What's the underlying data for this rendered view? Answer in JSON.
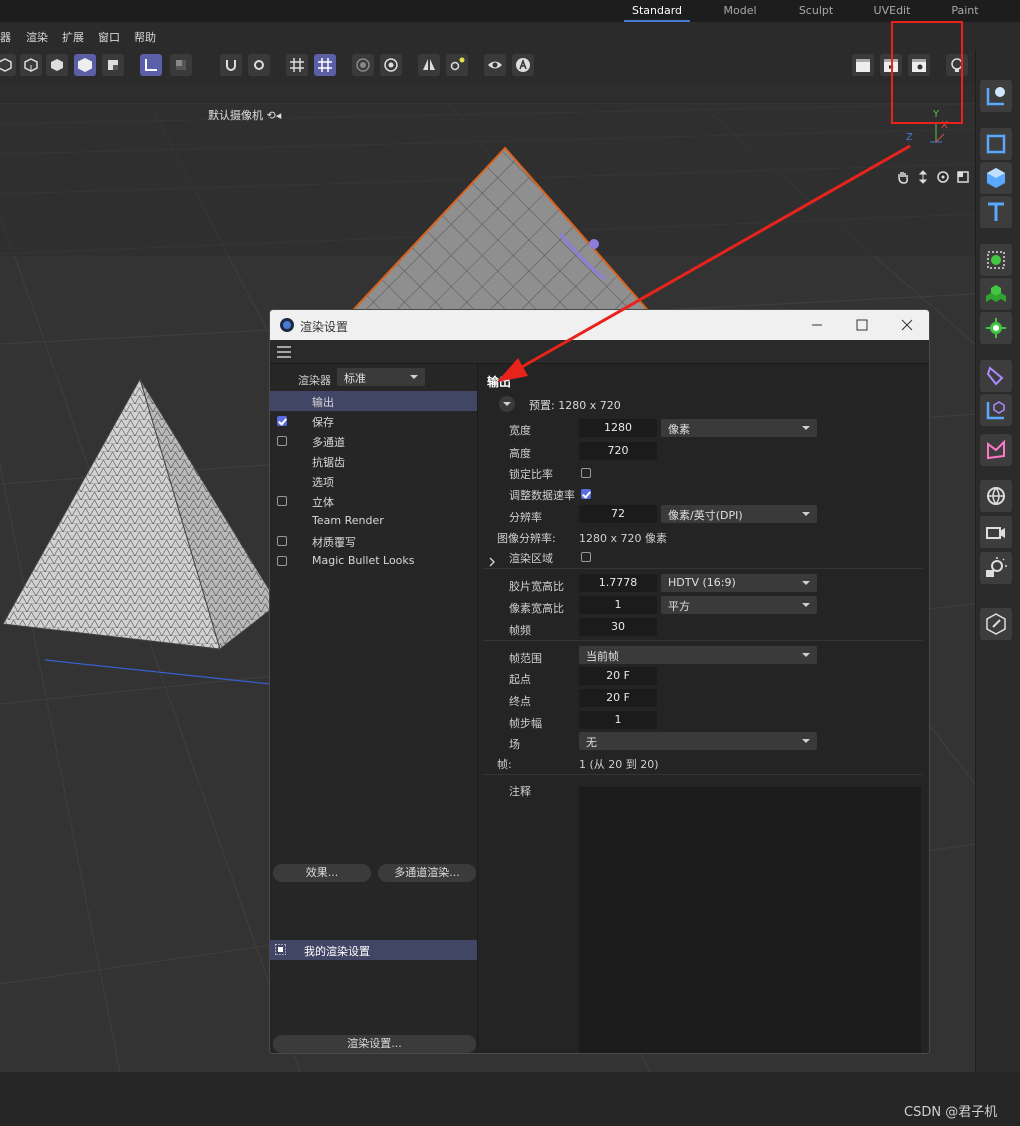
{
  "layout_tabs": [
    "Standard",
    "Model",
    "Sculpt",
    "UVEdit",
    "Paint"
  ],
  "menu": [
    "器",
    "渲染",
    "扩展",
    "窗口",
    "帮助"
  ],
  "viewport": {
    "camera_label": "默认摄像机 ⟲◂",
    "axes": {
      "y": "Y",
      "x": "X",
      "z": "Z"
    }
  },
  "watermark": "CSDN @君子机",
  "dialog": {
    "title": "渲染设置",
    "renderer_label": "渲染器",
    "renderer_value": "标准",
    "nav": [
      {
        "label": "输出",
        "checkbox": false,
        "checked": false,
        "selected": true
      },
      {
        "label": "保存",
        "checkbox": true,
        "checked": true,
        "selected": false
      },
      {
        "label": "多通道",
        "checkbox": true,
        "checked": false,
        "selected": false
      },
      {
        "label": "抗锯齿",
        "checkbox": false,
        "checked": false,
        "selected": false
      },
      {
        "label": "选项",
        "checkbox": false,
        "checked": false,
        "selected": false
      },
      {
        "label": "立体",
        "checkbox": true,
        "checked": false,
        "selected": false
      },
      {
        "label": "Team Render",
        "checkbox": false,
        "checked": false,
        "selected": false
      },
      {
        "label": "材质覆写",
        "checkbox": true,
        "checked": false,
        "selected": false
      },
      {
        "label": "Magic Bullet Looks",
        "checkbox": true,
        "checked": false,
        "selected": false
      }
    ],
    "effects_button": "效果...",
    "multipass_button": "多通道渲染...",
    "preset_item": "我的渲染设置",
    "render_settings_button": "渲染设置...",
    "output": {
      "section_title": "输出",
      "preset": "预置: 1280 x 720",
      "width_label": "宽度",
      "width_value": "1280",
      "unit_value": "像素",
      "height_label": "高度",
      "height_value": "720",
      "lock_ratio_label": "锁定比率",
      "lock_ratio_checked": false,
      "adjust_rate_label": "调整数据速率",
      "adjust_rate_checked": true,
      "resolution_label": "分辨率",
      "resolution_value": "72",
      "resolution_unit": "像素/英寸(DPI)",
      "image_res_label": "图像分辨率:",
      "image_res_value": "1280 x 720 像素",
      "render_region_label": "渲染区域",
      "render_region_checked": false,
      "film_aspect_label": "胶片宽高比",
      "film_aspect_value": "1.7778",
      "film_aspect_preset": "HDTV (16:9)",
      "pixel_aspect_label": "像素宽高比",
      "pixel_aspect_value": "1",
      "pixel_aspect_preset": "平方",
      "fps_label": "帧频",
      "fps_value": "30",
      "frame_range_label": "帧范围",
      "frame_range_value": "当前帧",
      "start_label": "起点",
      "start_value": "20 F",
      "end_label": "终点",
      "end_value": "20 F",
      "step_label": "帧步幅",
      "step_value": "1",
      "field_label": "场",
      "field_value": "无",
      "frames_label": "帧:",
      "frames_value": "1 (从 20 到 20)",
      "notes_label": "注释"
    }
  },
  "colors": {
    "accent": "#5b6be0",
    "selection": "#424666",
    "annotation": "#e8231b"
  }
}
